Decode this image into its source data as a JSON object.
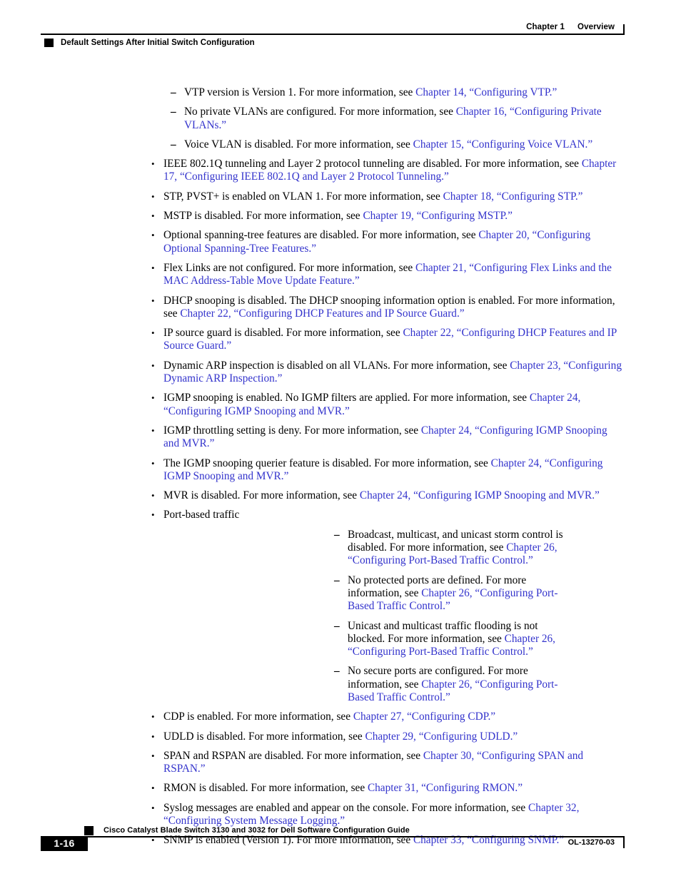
{
  "colors": {
    "link": "#3333cc",
    "text": "#000000",
    "rule": "#000000",
    "page_background": "#ffffff"
  },
  "header": {
    "chapter_label": "Chapter 1",
    "chapter_title": "Overview",
    "section_title": "Default Settings After Initial Switch Configuration",
    "square_icon": "black-square-icon"
  },
  "footer": {
    "page_number": "1-16",
    "document_title": "Cisco Catalyst Blade Switch 3130 and 3032 for Dell Software Configuration Guide",
    "document_id": "OL-13270-03",
    "square_icon": "black-square-icon"
  },
  "body": {
    "items": [
      {
        "level": 2,
        "marker": "–",
        "runs": [
          {
            "t": "VTP version is Version 1. For more information, see ",
            "link": false
          },
          {
            "t": "Chapter 14, “Configuring VTP.”",
            "link": true
          }
        ]
      },
      {
        "level": 2,
        "marker": "–",
        "runs": [
          {
            "t": "No private VLANs are configured. For more information, see ",
            "link": false
          },
          {
            "t": "Chapter 16, “Configuring Private VLANs.”",
            "link": true
          }
        ]
      },
      {
        "level": 2,
        "marker": "–",
        "runs": [
          {
            "t": "Voice VLAN is disabled. For more information, see ",
            "link": false
          },
          {
            "t": "Chapter 15, “Configuring Voice VLAN.”",
            "link": true
          }
        ]
      },
      {
        "level": 1,
        "marker": "•",
        "runs": [
          {
            "t": "IEEE 802.1Q tunneling and Layer 2 protocol tunneling are disabled. For more information, see ",
            "link": false
          },
          {
            "t": "Chapter 17, “Configuring IEEE 802.1Q and Layer 2 Protocol Tunneling.”",
            "link": true
          }
        ]
      },
      {
        "level": 1,
        "marker": "•",
        "runs": [
          {
            "t": "STP, PVST+ is enabled on VLAN 1. For more information, see ",
            "link": false
          },
          {
            "t": "Chapter 18, “Configuring STP.”",
            "link": true
          }
        ]
      },
      {
        "level": 1,
        "marker": "•",
        "runs": [
          {
            "t": "MSTP is disabled. For more information, see ",
            "link": false
          },
          {
            "t": "Chapter 19, “Configuring MSTP.”",
            "link": true
          }
        ]
      },
      {
        "level": 1,
        "marker": "•",
        "runs": [
          {
            "t": "Optional spanning-tree features are disabled. For more information, see ",
            "link": false
          },
          {
            "t": "Chapter 20, “Configuring Optional Spanning-Tree Features.”",
            "link": true
          }
        ]
      },
      {
        "level": 1,
        "marker": "•",
        "runs": [
          {
            "t": "Flex Links are not configured. For more information, see ",
            "link": false
          },
          {
            "t": "Chapter 21, “Configuring Flex Links and the MAC Address-Table Move Update Feature.”",
            "link": true
          }
        ]
      },
      {
        "level": 1,
        "marker": "•",
        "runs": [
          {
            "t": "DHCP snooping is disabled. The DHCP snooping information option is enabled. For more information, see ",
            "link": false
          },
          {
            "t": "Chapter 22, “Configuring DHCP Features and IP Source Guard.”",
            "link": true
          }
        ]
      },
      {
        "level": 1,
        "marker": "•",
        "runs": [
          {
            "t": "IP source guard is disabled. For more information, see ",
            "link": false
          },
          {
            "t": "Chapter 22, “Configuring DHCP Features and IP Source Guard.”",
            "link": true
          }
        ]
      },
      {
        "level": 1,
        "marker": "•",
        "runs": [
          {
            "t": "Dynamic ARP inspection is disabled on all VLANs. For more information, see ",
            "link": false
          },
          {
            "t": "Chapter 23, “Configuring Dynamic ARP Inspection.”",
            "link": true
          }
        ]
      },
      {
        "level": 1,
        "marker": "•",
        "runs": [
          {
            "t": "IGMP snooping is enabled. No IGMP filters are applied. For more information, see ",
            "link": false
          },
          {
            "t": "Chapter 24, “Configuring IGMP Snooping and MVR.”",
            "link": true
          }
        ]
      },
      {
        "level": 1,
        "marker": "•",
        "runs": [
          {
            "t": "IGMP throttling setting is deny. For more information, see ",
            "link": false
          },
          {
            "t": "Chapter 24, “Configuring IGMP Snooping and MVR.”",
            "link": true
          }
        ]
      },
      {
        "level": 1,
        "marker": "•",
        "runs": [
          {
            "t": "The IGMP snooping querier feature is disabled. For more information, see ",
            "link": false
          },
          {
            "t": "Chapter 24, “Configuring IGMP Snooping and MVR.”",
            "link": true
          }
        ]
      },
      {
        "level": 1,
        "marker": "•",
        "runs": [
          {
            "t": "MVR is disabled. For more information, see ",
            "link": false
          },
          {
            "t": "Chapter 24, “Configuring IGMP Snooping and MVR.”",
            "link": true
          }
        ]
      },
      {
        "level": 1,
        "marker": "•",
        "runs": [
          {
            "t": "Port-based traffic",
            "link": false
          }
        ]
      },
      {
        "level": 2,
        "marker": "–",
        "runs": [
          {
            "t": "Broadcast, multicast, and unicast storm control is disabled. For more information, see ",
            "link": false
          },
          {
            "t": "Chapter 26, “Configuring Port-Based Traffic Control.”",
            "link": true
          }
        ]
      },
      {
        "level": 2,
        "marker": "–",
        "runs": [
          {
            "t": "No protected ports are defined. For more information, see ",
            "link": false
          },
          {
            "t": "Chapter 26, “Configuring Port-Based Traffic Control.”",
            "link": true
          }
        ]
      },
      {
        "level": 2,
        "marker": "–",
        "runs": [
          {
            "t": "Unicast and multicast traffic flooding is not blocked. For more information, see ",
            "link": false
          },
          {
            "t": "Chapter 26, “Configuring Port-Based Traffic Control.”",
            "link": true
          }
        ]
      },
      {
        "level": 2,
        "marker": "–",
        "runs": [
          {
            "t": "No secure ports are configured. For more information, see ",
            "link": false
          },
          {
            "t": "Chapter 26, “Configuring Port-Based Traffic Control.”",
            "link": true
          }
        ]
      },
      {
        "level": 1,
        "marker": "•",
        "runs": [
          {
            "t": "CDP is enabled. For more information, see ",
            "link": false
          },
          {
            "t": "Chapter 27, “Configuring CDP.”",
            "link": true
          }
        ]
      },
      {
        "level": 1,
        "marker": "•",
        "runs": [
          {
            "t": "UDLD is disabled. For more information, see ",
            "link": false
          },
          {
            "t": "Chapter 29, “Configuring UDLD.”",
            "link": true
          }
        ]
      },
      {
        "level": 1,
        "marker": "•",
        "runs": [
          {
            "t": "SPAN and RSPAN are disabled. For more information, see ",
            "link": false
          },
          {
            "t": "Chapter 30, “Configuring SPAN and RSPAN.”",
            "link": true
          }
        ]
      },
      {
        "level": 1,
        "marker": "•",
        "runs": [
          {
            "t": "RMON is disabled. For more information, see ",
            "link": false
          },
          {
            "t": "Chapter 31, “Configuring RMON.”",
            "link": true
          }
        ]
      },
      {
        "level": 1,
        "marker": "•",
        "runs": [
          {
            "t": "Syslog messages are enabled and appear on the console. For more information, see ",
            "link": false
          },
          {
            "t": "Chapter 32, “Configuring System Message Logging.”",
            "link": true
          }
        ]
      },
      {
        "level": 1,
        "marker": "•",
        "runs": [
          {
            "t": "SNMP is enabled (Version 1). For more information, see ",
            "link": false
          },
          {
            "t": "Chapter 33, “Configuring SNMP.”",
            "link": true
          }
        ]
      }
    ]
  }
}
